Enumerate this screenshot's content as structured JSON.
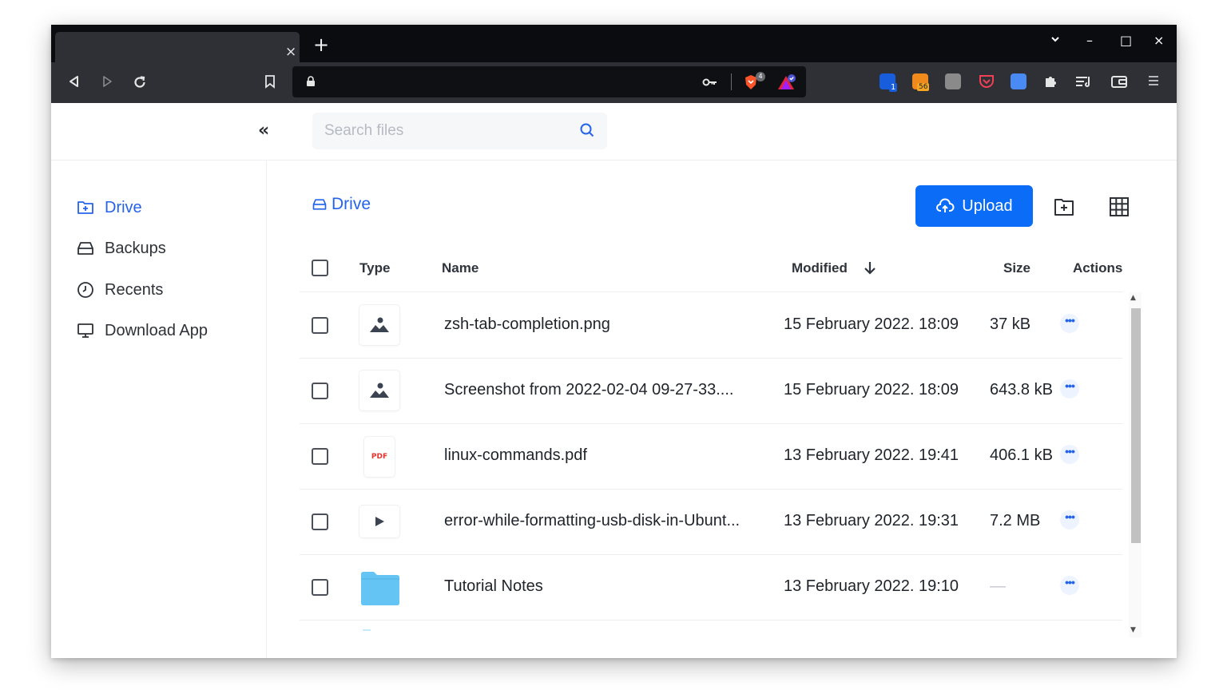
{
  "browser": {
    "tab_close": "×",
    "new_tab": "+",
    "window_controls": {
      "dropdown": "⌄",
      "minimize": "–",
      "maximize": "□",
      "close": "×"
    },
    "extensions": [
      {
        "name": "bitwarden-icon",
        "badge": "1",
        "color": "#175ddc"
      },
      {
        "name": "feedly-icon",
        "badge": "56",
        "color": "#f08a1c"
      },
      {
        "name": "tb-icon",
        "color": "#8a8a8a"
      },
      {
        "name": "pocket-icon",
        "color": "#ef4056"
      },
      {
        "name": "translate-icon",
        "color": "#4a8af4"
      }
    ],
    "brave_badge": "4"
  },
  "search": {
    "placeholder": "Search files",
    "value": ""
  },
  "sidebar": {
    "items": [
      {
        "label": "Drive",
        "icon": "drive-folder-icon",
        "active": true
      },
      {
        "label": "Backups",
        "icon": "hard-drive-icon",
        "active": false
      },
      {
        "label": "Recents",
        "icon": "clock-icon",
        "active": false
      },
      {
        "label": "Download App",
        "icon": "desktop-icon",
        "active": false
      }
    ]
  },
  "main": {
    "breadcrumb": "Drive",
    "upload_label": "Upload",
    "columns": {
      "type": "Type",
      "name": "Name",
      "modified": "Modified",
      "size": "Size",
      "actions": "Actions"
    },
    "rows": [
      {
        "type": "image",
        "name": "zsh-tab-completion.png",
        "modified": "15 February 2022. 18:09",
        "size": "37 kB"
      },
      {
        "type": "image",
        "name": "Screenshot from 2022-02-04 09-27-33....",
        "modified": "15 February 2022. 18:09",
        "size": "643.8 kB"
      },
      {
        "type": "pdf",
        "type_label": "PDF",
        "name": "linux-commands.pdf",
        "modified": "13 February 2022. 19:41",
        "size": "406.1 kB"
      },
      {
        "type": "video",
        "name": "error-while-formatting-usb-disk-in-Ubunt...",
        "modified": "13 February 2022. 19:31",
        "size": "7.2 MB"
      },
      {
        "type": "folder",
        "name": "Tutorial Notes",
        "modified": "13 February 2022. 19:10",
        "size": "—"
      }
    ],
    "actions_label": "•••"
  },
  "colors": {
    "accent": "#2563eb",
    "upload_button": "#0b6cf7",
    "folder": "#64c5f4"
  }
}
